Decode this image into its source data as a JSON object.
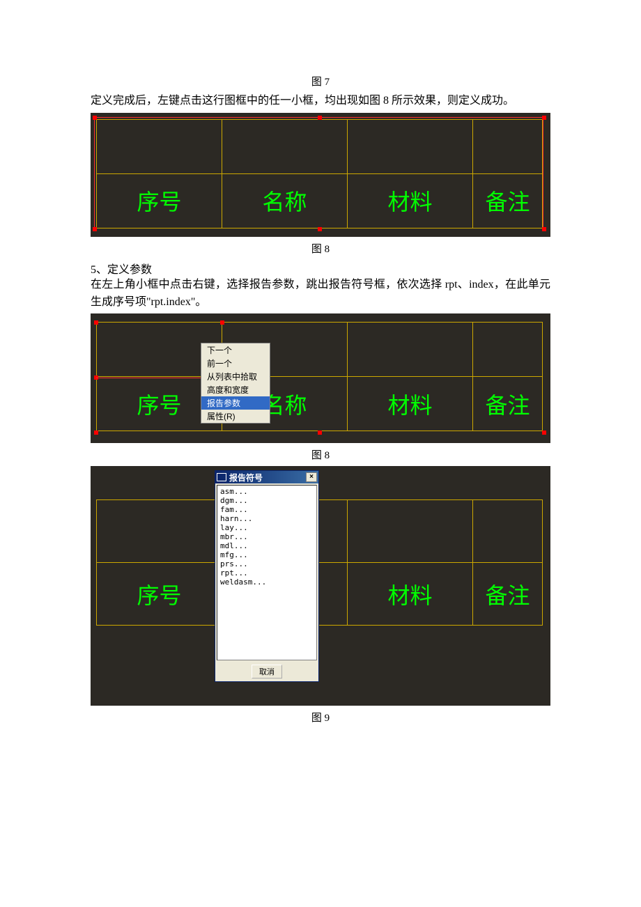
{
  "captions": {
    "fig7": "图 7",
    "fig8a": "图 8",
    "fig8b": "图 8",
    "fig9": "图 9"
  },
  "paragraphs": {
    "p1": "定义完成后，左键点击这行图框中的任一小框，均出现如图 8 所示效果，则定义成功。",
    "s5_title": "5、定义参数",
    "p2": "在左上角小框中点击右键，选择报告参数，跳出报告符号框，依次选择 rpt、index，在此单元生成序号项\"rpt.index\"。"
  },
  "table_headers": {
    "col1": "序号",
    "col2": "名称",
    "col3": "材料",
    "col4": "备注"
  },
  "context_menu": {
    "items": [
      "下一个",
      "前一个",
      "从列表中拾取",
      "高度和宽度",
      "报告参数",
      "属性(R)"
    ],
    "highlighted_index": 4
  },
  "dialog": {
    "title": "报告符号",
    "items": [
      "asm...",
      "dgm...",
      "fam...",
      "harn...",
      "lay...",
      "mbr...",
      "mdl...",
      "mfg...",
      "prs...",
      "rpt...",
      "weldasm..."
    ],
    "cancel_label": "取消"
  }
}
